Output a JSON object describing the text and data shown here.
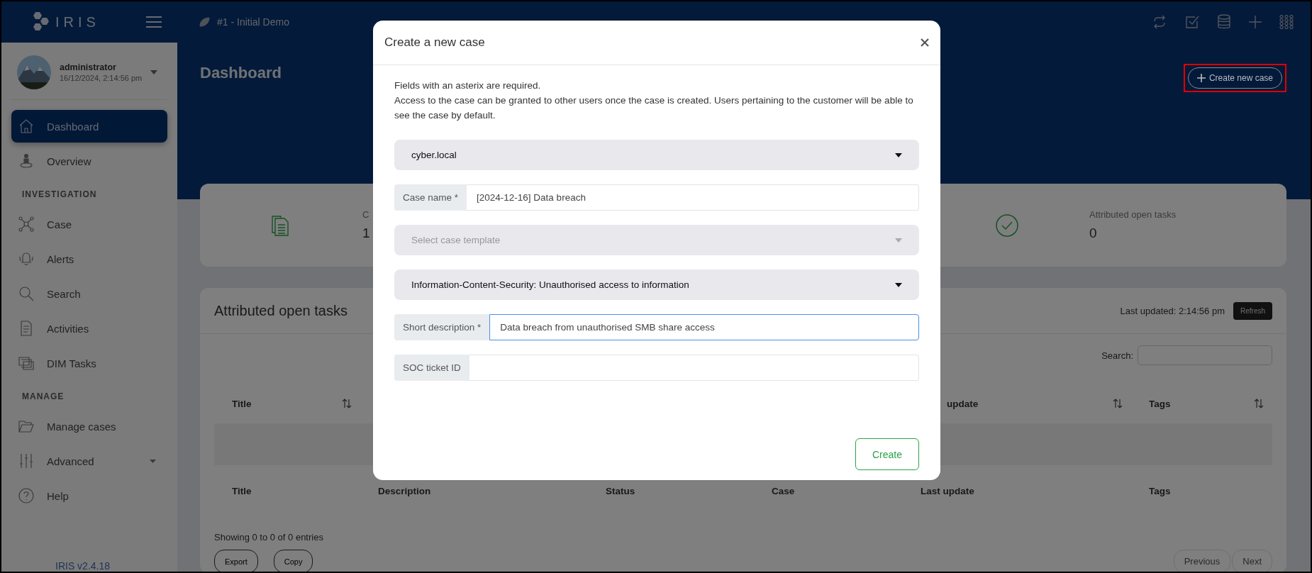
{
  "topbar": {
    "logo": "IRIS",
    "breadcrumb": "#1 - Initial Demo"
  },
  "sidebar": {
    "user": {
      "name": "administrator",
      "datetime": "16/12/2024, 2:14:56 pm"
    },
    "sections": [
      {
        "items": [
          {
            "label": "Dashboard",
            "selected": true,
            "has_submenu": false
          },
          {
            "label": "Overview",
            "selected": false,
            "has_submenu": false
          }
        ]
      },
      {
        "heading": "INVESTIGATION",
        "items": [
          {
            "label": "Case",
            "selected": false,
            "has_submenu": false
          },
          {
            "label": "Alerts",
            "selected": false,
            "has_submenu": false
          },
          {
            "label": "Search",
            "selected": false,
            "has_submenu": false
          },
          {
            "label": "Activities",
            "selected": false,
            "has_submenu": false
          },
          {
            "label": "DIM Tasks",
            "selected": false,
            "has_submenu": false
          }
        ]
      },
      {
        "heading": "MANAGE",
        "items": [
          {
            "label": "Manage cases",
            "selected": false,
            "has_submenu": false
          },
          {
            "label": "Advanced",
            "selected": false,
            "has_submenu": true
          },
          {
            "label": "Help",
            "selected": false,
            "has_submenu": false
          }
        ]
      }
    ],
    "version": "IRIS v2.4.18"
  },
  "header": {
    "title": "Dashboard",
    "button": {
      "label": "Create new case",
      "highlighted": true
    }
  },
  "stats": {
    "left": {
      "label": "C",
      "value": "1"
    },
    "right": {
      "label": "Attributed open tasks",
      "value": "0"
    }
  },
  "tasks": {
    "title": "Attributed open tasks",
    "last_updated": "Last updated: 2:14:56 pm",
    "refresh": "Refresh",
    "search_label": "Search:",
    "header_cells": [
      "Title",
      "",
      "",
      "",
      "update",
      "Tags"
    ],
    "sortable": [
      true,
      false,
      false,
      false,
      true,
      true
    ],
    "footer_cells": [
      "Title",
      "Description",
      "Status",
      "Case",
      "Last update",
      "Tags"
    ],
    "info": "Showing 0 to 0 of 0 entries",
    "buttons": [
      "Export",
      "Copy"
    ],
    "pager": [
      "Previous",
      "Next"
    ]
  },
  "modal": {
    "title": "Create a new case",
    "intro": [
      "Fields with an asterix are required.",
      "Access to the case can be granted to other users once the case is created. Users pertaining to the customer will be able to see the case by default."
    ],
    "fields": [
      {
        "kind": "select",
        "value": "cyber.local"
      },
      {
        "kind": "input",
        "label": "Case name *",
        "value": "[2024-12-16] Data breach",
        "focused": false
      },
      {
        "kind": "select",
        "placeholder": "Select case template"
      },
      {
        "kind": "select",
        "value": "Information-Content-Security: Unauthorised access to information"
      },
      {
        "kind": "input",
        "label": "Short description *",
        "value": "Data breach from unauthorised SMB share access",
        "focused": true
      },
      {
        "kind": "input",
        "label": "SOC ticket ID",
        "focused": false
      }
    ],
    "submit": "Create"
  }
}
